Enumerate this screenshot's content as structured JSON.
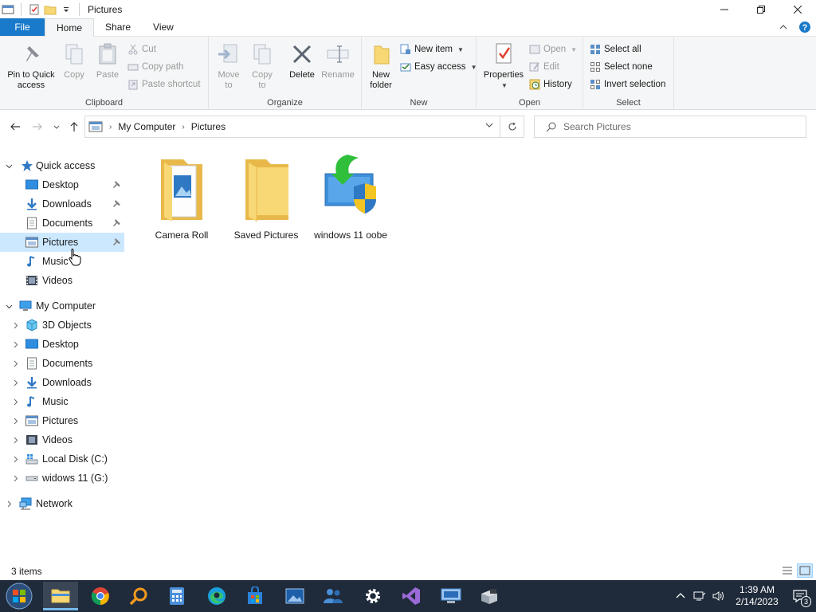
{
  "window": {
    "title": "Pictures"
  },
  "ribbon": {
    "tabs": [
      "File",
      "Home",
      "Share",
      "View"
    ],
    "active_tab": "Home",
    "clipboard": {
      "pin_line1": "Pin to Quick",
      "pin_line2": "access",
      "copy": "Copy",
      "paste": "Paste",
      "cut": "Cut",
      "copy_path": "Copy path",
      "paste_shortcut": "Paste shortcut",
      "label": "Clipboard"
    },
    "organize": {
      "move_line1": "Move",
      "move_line2": "to",
      "copy_line1": "Copy",
      "copy_line2": "to",
      "delete": "Delete",
      "rename": "Rename",
      "label": "Organize"
    },
    "new": {
      "folder_line1": "New",
      "folder_line2": "folder",
      "new_item": "New item",
      "easy_access": "Easy access",
      "label": "New"
    },
    "open": {
      "properties": "Properties",
      "open": "Open",
      "edit": "Edit",
      "history": "History",
      "label": "Open"
    },
    "select": {
      "select_all": "Select all",
      "select_none": "Select none",
      "invert": "Invert selection",
      "label": "Select"
    }
  },
  "address": {
    "crumbs": [
      "My Computer",
      "Pictures"
    ],
    "search_placeholder": "Search Pictures"
  },
  "nav": {
    "quick_access": "Quick access",
    "quick_items": [
      {
        "label": "Desktop",
        "pinned": true
      },
      {
        "label": "Downloads",
        "pinned": true
      },
      {
        "label": "Documents",
        "pinned": true
      },
      {
        "label": "Pictures",
        "pinned": true,
        "selected": true
      },
      {
        "label": "Music",
        "pinned": false
      },
      {
        "label": "Videos",
        "pinned": false
      }
    ],
    "my_computer": "My Computer",
    "computer_items": [
      "3D Objects",
      "Desktop",
      "Documents",
      "Downloads",
      "Music",
      "Pictures",
      "Videos",
      "Local Disk (C:)",
      "widows 11 (G:)"
    ],
    "network": "Network"
  },
  "content": {
    "items": [
      {
        "name": "Camera Roll",
        "icon": "folder-pictures-icon"
      },
      {
        "name": "Saved Pictures",
        "icon": "folder-icon"
      },
      {
        "name": "windows 11 oobe",
        "icon": "installer-shield-icon"
      }
    ]
  },
  "status": {
    "item_count": "3 items"
  },
  "taskbar": {
    "time": "1:39 AM",
    "date": "2/14/2023",
    "notification_count": "3"
  },
  "colors": {
    "file_tab": "#1979ca",
    "selection": "#cce8ff",
    "taskbar": "#1f2b3b",
    "folder": "#f8d775"
  }
}
